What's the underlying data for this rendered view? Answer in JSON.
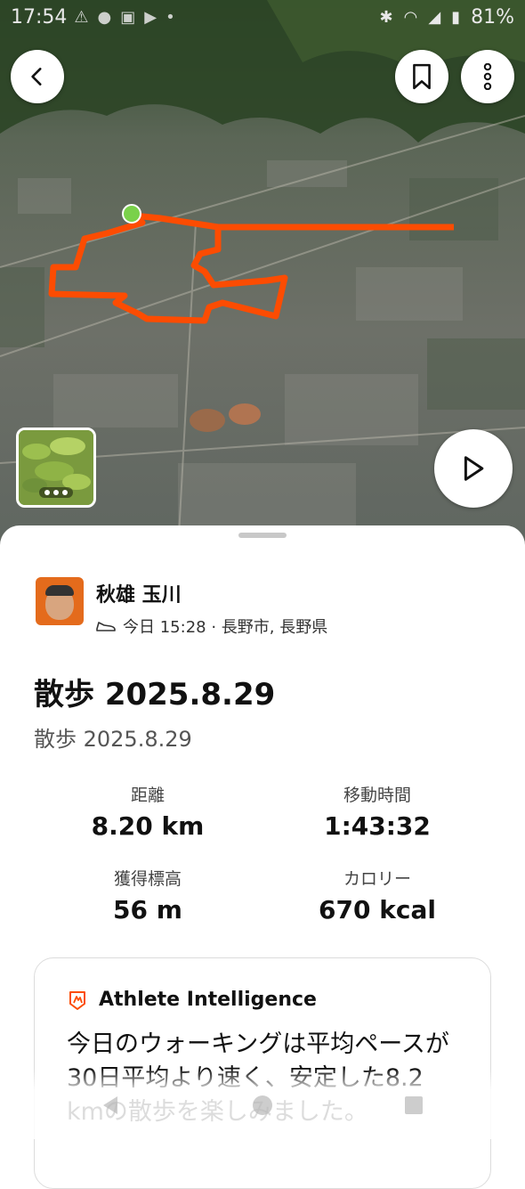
{
  "status_bar": {
    "time": "17:54",
    "battery": "81%"
  },
  "colors": {
    "route": "#fc4c02",
    "start_marker": "#7ad14a",
    "accent": "#fc4c02"
  },
  "map": {
    "back_icon": "chevron-left-icon",
    "bookmark_icon": "bookmark-icon",
    "more_icon": "more-vertical-icon",
    "play_icon": "play-icon",
    "photo_thumbnail": "photo-thumbnail"
  },
  "activity": {
    "athlete_name": "秋雄 玉川",
    "meta": "今日 15:28 · 長野市, 長野県",
    "title": "散歩 2025.8.29",
    "subtitle": "散歩 2025.8.29"
  },
  "stats": [
    {
      "label": "距離",
      "value": "8.20 km"
    },
    {
      "label": "移動時間",
      "value": "1:43:32"
    },
    {
      "label": "獲得標高",
      "value": "56 m"
    },
    {
      "label": "カロリー",
      "value": "670 kcal"
    }
  ],
  "athlete_intelligence": {
    "label": "Athlete Intelligence",
    "text": "今日のウォーキングは平均ペースが30日平均より速く、安定した8.2 kmの散歩を楽しみました。"
  }
}
